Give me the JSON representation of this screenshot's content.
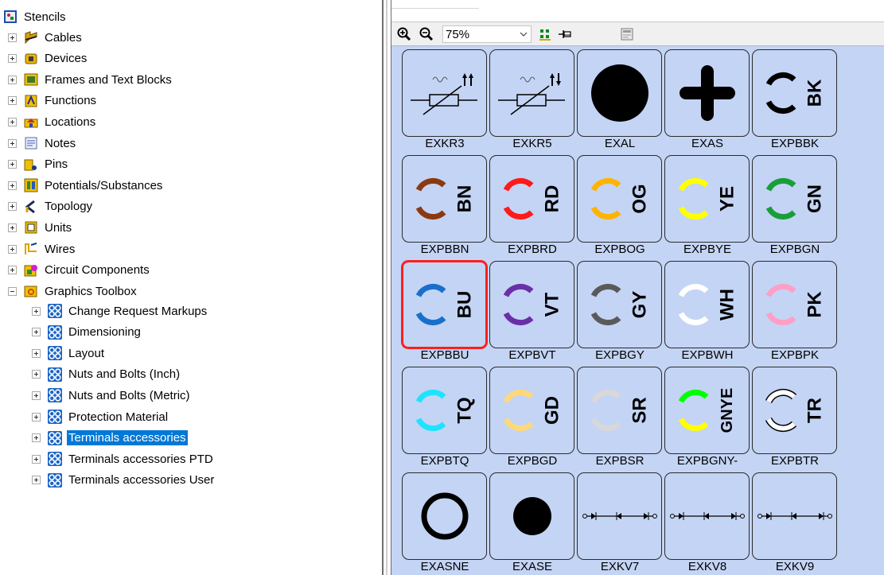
{
  "tree": {
    "root": {
      "label": "Stencils",
      "icon": "stencil-book-icon"
    },
    "items": [
      {
        "label": "Cables",
        "icon": "cable-icon",
        "expander": "plus"
      },
      {
        "label": "Devices",
        "icon": "device-icon",
        "expander": "plus"
      },
      {
        "label": "Frames and Text Blocks",
        "icon": "frame-icon",
        "expander": "plus"
      },
      {
        "label": "Functions",
        "icon": "function-icon",
        "expander": "plus"
      },
      {
        "label": "Locations",
        "icon": "location-icon",
        "expander": "plus"
      },
      {
        "label": "Notes",
        "icon": "notes-icon",
        "expander": "plus"
      },
      {
        "label": "Pins",
        "icon": "pin-icon",
        "expander": "plus"
      },
      {
        "label": "Potentials/Substances",
        "icon": "potential-icon",
        "expander": "plus"
      },
      {
        "label": "Topology",
        "icon": "topology-icon",
        "expander": "plus"
      },
      {
        "label": "Units",
        "icon": "unit-icon",
        "expander": "plus"
      },
      {
        "label": "Wires",
        "icon": "wire-icon",
        "expander": "plus"
      },
      {
        "label": "Circuit Components",
        "icon": "circuit-components-icon",
        "expander": "plus"
      },
      {
        "label": "Graphics Toolbox",
        "icon": "graphics-toolbox-icon",
        "expander": "minus"
      }
    ],
    "children": [
      {
        "label": "Change Request Markups",
        "icon": "stencil-group-icon"
      },
      {
        "label": "Dimensioning",
        "icon": "stencil-group-icon"
      },
      {
        "label": "Layout",
        "icon": "stencil-group-icon"
      },
      {
        "label": "Nuts and Bolts (Inch)",
        "icon": "stencil-group-icon"
      },
      {
        "label": "Nuts and Bolts (Metric)",
        "icon": "stencil-group-icon"
      },
      {
        "label": "Protection Material",
        "icon": "stencil-group-icon"
      },
      {
        "label": "Terminals accessories",
        "icon": "stencil-group-icon",
        "selected": true
      },
      {
        "label": "Terminals accessories PTD",
        "icon": "stencil-group-icon"
      },
      {
        "label": "Terminals accessories User",
        "icon": "stencil-group-icon"
      }
    ]
  },
  "toolbar": {
    "zoom_in_icon": "zoom-in-icon",
    "zoom_out_icon": "zoom-out-icon",
    "zoom_value": "75%",
    "view_icon": "large-icons-view-icon",
    "pin_icon": "pin-icon",
    "preview_icon": "preview-icon"
  },
  "symbols": [
    {
      "name": "EXKR3",
      "kind": "resistor",
      "arrows": "up-up"
    },
    {
      "name": "EXKR5",
      "kind": "resistor",
      "arrows": "up-down"
    },
    {
      "name": "EXAL",
      "kind": "dot"
    },
    {
      "name": "EXAS",
      "kind": "plus"
    },
    {
      "name": "EXPBBK",
      "kind": "ring",
      "code": "BK",
      "color": "#000000"
    },
    {
      "name": "EXPBBN",
      "kind": "ring",
      "code": "BN",
      "color": "#8b3a0f"
    },
    {
      "name": "EXPBRD",
      "kind": "ring",
      "code": "RD",
      "color": "#ff1a1a"
    },
    {
      "name": "EXPBOG",
      "kind": "ring",
      "code": "OG",
      "color": "#ffb300"
    },
    {
      "name": "EXPBYE",
      "kind": "ring",
      "code": "YE",
      "color": "#ffff00"
    },
    {
      "name": "EXPBGN",
      "kind": "ring",
      "code": "GN",
      "color": "#1a9e3a"
    },
    {
      "name": "EXPBBU",
      "kind": "ring",
      "code": "BU",
      "color": "#1a6fcc",
      "selected": true
    },
    {
      "name": "EXPBVT",
      "kind": "ring",
      "code": "VT",
      "color": "#6a2fa8"
    },
    {
      "name": "EXPBGY",
      "kind": "ring",
      "code": "GY",
      "color": "#5a5a5a"
    },
    {
      "name": "EXPBWH",
      "kind": "ring",
      "code": "WH",
      "color": "#ffffff"
    },
    {
      "name": "EXPBPK",
      "kind": "ring",
      "code": "PK",
      "color": "#ff9fc6"
    },
    {
      "name": "EXPBTQ",
      "kind": "ring",
      "code": "TQ",
      "color": "#1ee3ff"
    },
    {
      "name": "EXPBGD",
      "kind": "ring",
      "code": "GD",
      "color": "#ffd978"
    },
    {
      "name": "EXPBSR",
      "kind": "ring",
      "code": "SR",
      "color": "#d8d8d8"
    },
    {
      "name": "EXPBGNY-",
      "kind": "ring2",
      "code": "GNYE",
      "color": "#00ff00",
      "color2": "#ffff00"
    },
    {
      "name": "EXPBTR",
      "kind": "ring-outline",
      "code": "TR",
      "color": "#000000"
    },
    {
      "name": "EXASNE",
      "kind": "circle-outline"
    },
    {
      "name": "EXASE",
      "kind": "dot-small"
    },
    {
      "name": "EXKV7",
      "kind": "line-diodes"
    },
    {
      "name": "EXKV8",
      "kind": "line-diodes"
    },
    {
      "name": "EXKV9",
      "kind": "line-diodes"
    }
  ]
}
